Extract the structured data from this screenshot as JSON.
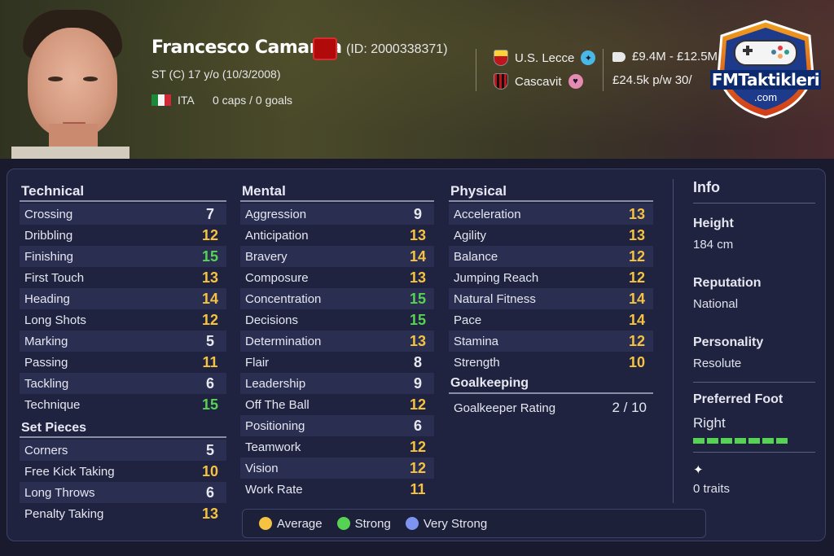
{
  "player": {
    "name": "Francesco Camarda",
    "id_text": "(ID: 2000338371)",
    "position_age": "ST (C)   17 y/o (10/3/2008)",
    "nationality": "ITA",
    "caps": "0 caps / 0 goals"
  },
  "clubs": {
    "current": "U.S. Lecce",
    "loan_from": "Cascavit"
  },
  "value": {
    "range": "£9.4M - £12.5M",
    "wage": "£24.5k p/w  30/"
  },
  "logo": {
    "main": "FMTaktikleri",
    "sub": ".com"
  },
  "technical": {
    "title": "Technical",
    "items": [
      {
        "label": "Crossing",
        "value": "7"
      },
      {
        "label": "Dribbling",
        "value": "12"
      },
      {
        "label": "Finishing",
        "value": "15"
      },
      {
        "label": "First Touch",
        "value": "13"
      },
      {
        "label": "Heading",
        "value": "14"
      },
      {
        "label": "Long Shots",
        "value": "12"
      },
      {
        "label": "Marking",
        "value": "5"
      },
      {
        "label": "Passing",
        "value": "11"
      },
      {
        "label": "Tackling",
        "value": "6"
      },
      {
        "label": "Technique",
        "value": "15"
      }
    ]
  },
  "set_pieces": {
    "title": "Set Pieces",
    "items": [
      {
        "label": "Corners",
        "value": "5"
      },
      {
        "label": "Free Kick Taking",
        "value": "10"
      },
      {
        "label": "Long Throws",
        "value": "6"
      },
      {
        "label": "Penalty Taking",
        "value": "13"
      }
    ]
  },
  "mental": {
    "title": "Mental",
    "items": [
      {
        "label": "Aggression",
        "value": "9"
      },
      {
        "label": "Anticipation",
        "value": "13"
      },
      {
        "label": "Bravery",
        "value": "14"
      },
      {
        "label": "Composure",
        "value": "13"
      },
      {
        "label": "Concentration",
        "value": "15"
      },
      {
        "label": "Decisions",
        "value": "15"
      },
      {
        "label": "Determination",
        "value": "13"
      },
      {
        "label": "Flair",
        "value": "8"
      },
      {
        "label": "Leadership",
        "value": "9"
      },
      {
        "label": "Off The Ball",
        "value": "12"
      },
      {
        "label": "Positioning",
        "value": "6"
      },
      {
        "label": "Teamwork",
        "value": "12"
      },
      {
        "label": "Vision",
        "value": "12"
      },
      {
        "label": "Work Rate",
        "value": "11"
      }
    ]
  },
  "physical": {
    "title": "Physical",
    "items": [
      {
        "label": "Acceleration",
        "value": "13"
      },
      {
        "label": "Agility",
        "value": "13"
      },
      {
        "label": "Balance",
        "value": "12"
      },
      {
        "label": "Jumping Reach",
        "value": "12"
      },
      {
        "label": "Natural Fitness",
        "value": "14"
      },
      {
        "label": "Pace",
        "value": "14"
      },
      {
        "label": "Stamina",
        "value": "12"
      },
      {
        "label": "Strength",
        "value": "10"
      }
    ]
  },
  "goalkeeping": {
    "title": "Goalkeeping",
    "label": "Goalkeeper Rating",
    "value": "2 / 10"
  },
  "info": {
    "title": "Info",
    "height_label": "Height",
    "height_value": "184 cm",
    "reputation_label": "Reputation",
    "reputation_value": "National",
    "personality_label": "Personality",
    "personality_value": "Resolute",
    "foot_label": "Preferred Foot",
    "foot_value": "Right",
    "foot_bar_segments": 7,
    "traits": "0 traits"
  },
  "legend": {
    "average": "Average",
    "strong": "Strong",
    "very_strong": "Very Strong"
  },
  "colors": {
    "average": "#f5c242",
    "strong": "#57d354",
    "very_strong": "#7d95f0",
    "red_card": "#b00a0a"
  }
}
